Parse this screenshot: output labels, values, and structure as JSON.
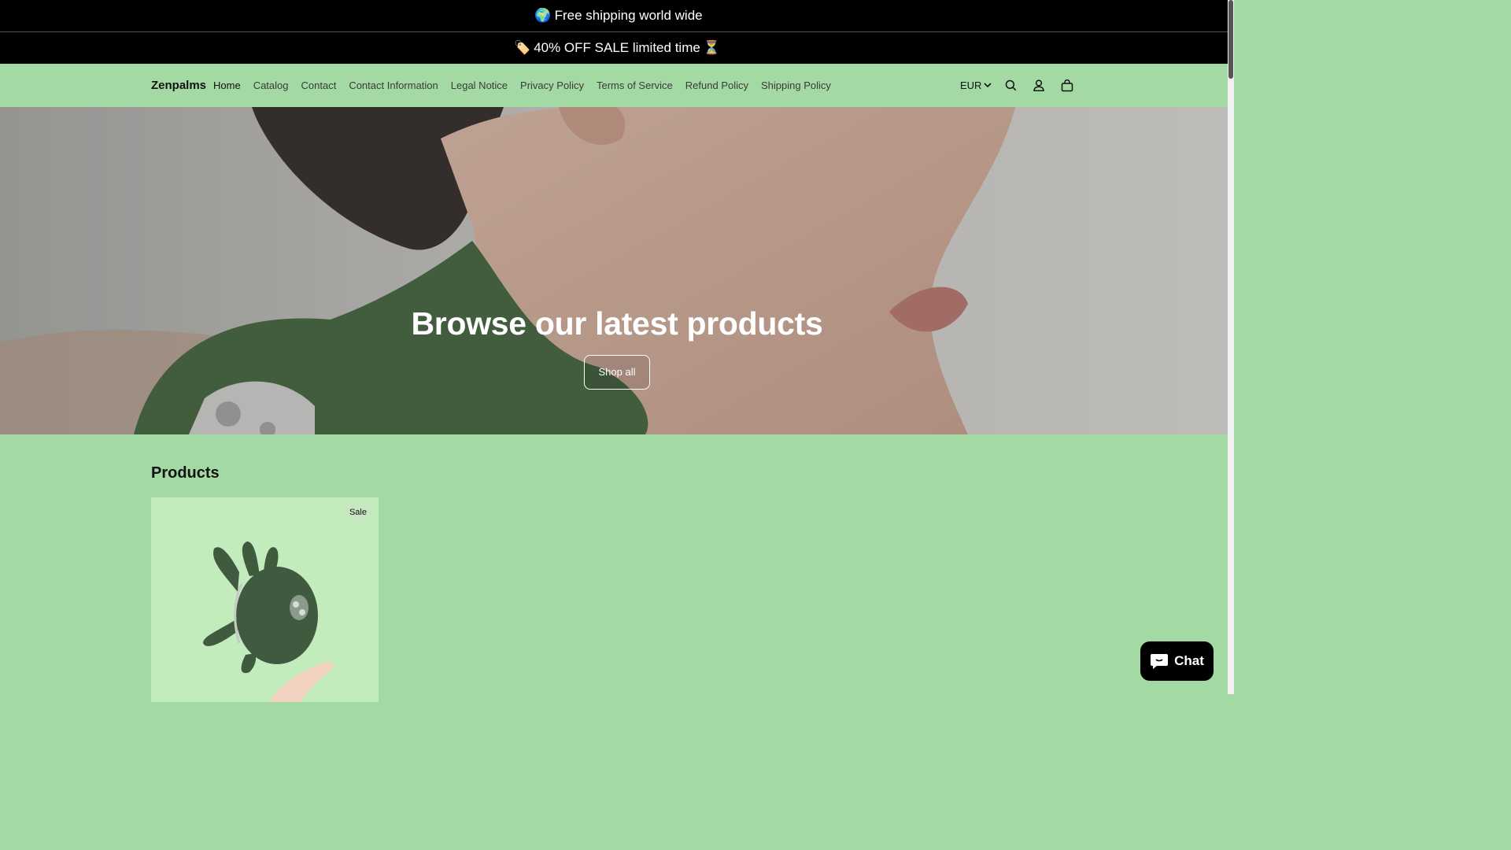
{
  "announcements": [
    {
      "emoji": "🌍",
      "text": "Free shipping world wide",
      "emoji_after": ""
    },
    {
      "emoji": "🏷️",
      "text": "40% OFF SALE limited time",
      "emoji_after": "⏳"
    }
  ],
  "header": {
    "logo": "Zenpalms",
    "nav": [
      "Home",
      "Catalog",
      "Contact",
      "Contact Information",
      "Legal Notice",
      "Privacy Policy",
      "Terms of Service",
      "Refund Policy",
      "Shipping Policy"
    ],
    "currency": "EUR",
    "icons": [
      "search-icon",
      "account-icon",
      "cart-icon"
    ]
  },
  "hero": {
    "title": "Browse our latest products",
    "button": "Shop all"
  },
  "products": {
    "title": "Products",
    "items": [
      {
        "badge": "Sale"
      }
    ]
  },
  "chat": {
    "label": "Chat"
  },
  "colors": {
    "background": "#a3d9a2",
    "announcement": "#000000",
    "card": "#c2ecbc",
    "product_green": "#3f5a3f"
  }
}
